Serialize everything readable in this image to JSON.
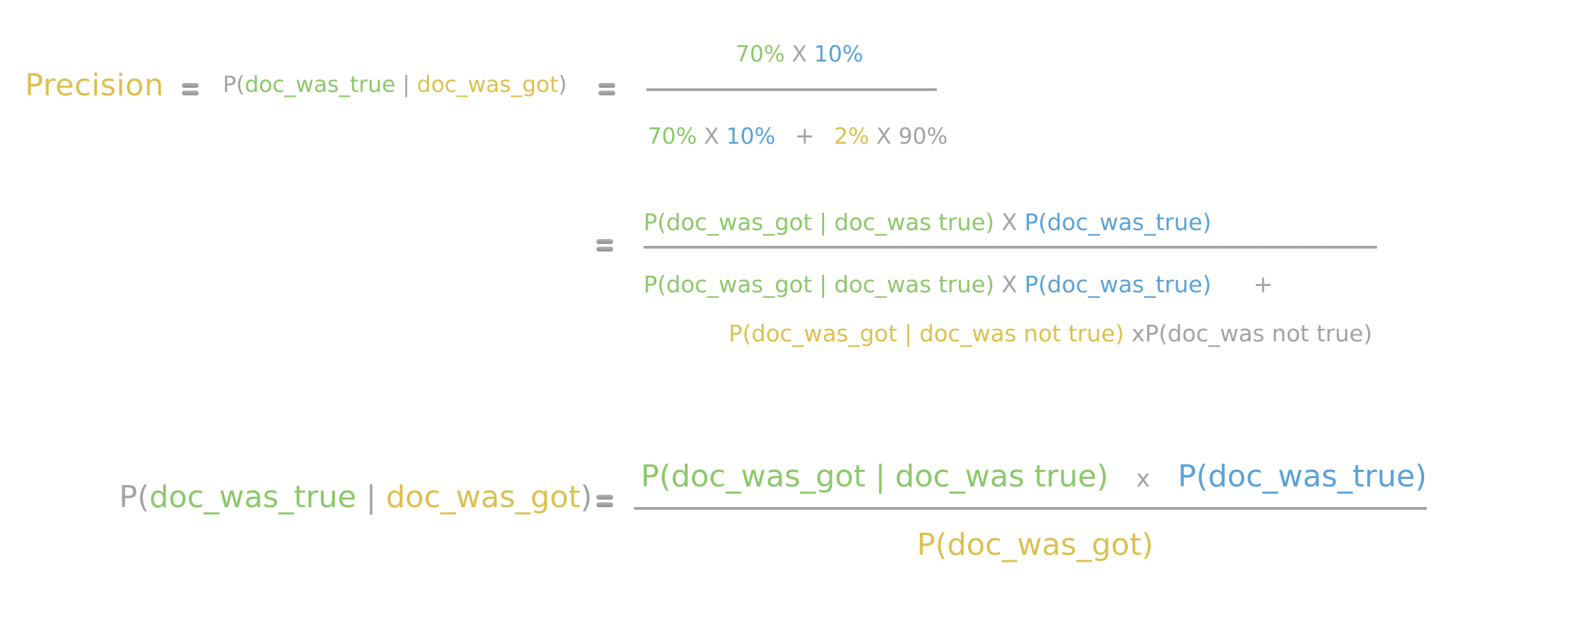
{
  "colors": {
    "yellow": "#dcc050",
    "green": "#8cc86a",
    "blue": "#5aa2d8",
    "gray": "#a3a3a3"
  },
  "eq1": {
    "lhs": "Precision",
    "p_open": "P(",
    "event": "doc_was_true",
    "given": " | ",
    "condition": "doc_was_got",
    "p_close": ")",
    "numerator": {
      "a": "70%",
      "times": "X",
      "b": "10%"
    },
    "denominator": {
      "a": "70%",
      "times1": "X",
      "b": "10%",
      "plus": "+",
      "c": "2%",
      "times2": "X",
      "d": "90%"
    }
  },
  "eq2": {
    "numerator": {
      "likelihood": "P(doc_was_got | doc_was true)",
      "times": "X",
      "prior": "P(doc_was_true)"
    },
    "denominator": {
      "likelihood": "P(doc_was_got | doc_was true)",
      "times": "X",
      "prior": "P(doc_was_true)",
      "plus": "+",
      "false_likelihood": "P(doc_was_got | doc_was not true)",
      "times2": "x",
      "not_prior": "P(doc_was not true)"
    }
  },
  "eq3": {
    "p_open": "P(",
    "event": "doc_was_true",
    "given": " | ",
    "condition": "doc_was_got",
    "p_close": ")",
    "numerator": {
      "likelihood": "P(doc_was_got | doc_was true)",
      "times": "x",
      "prior": "P(doc_was_true)"
    },
    "denominator": "P(doc_was_got)"
  }
}
